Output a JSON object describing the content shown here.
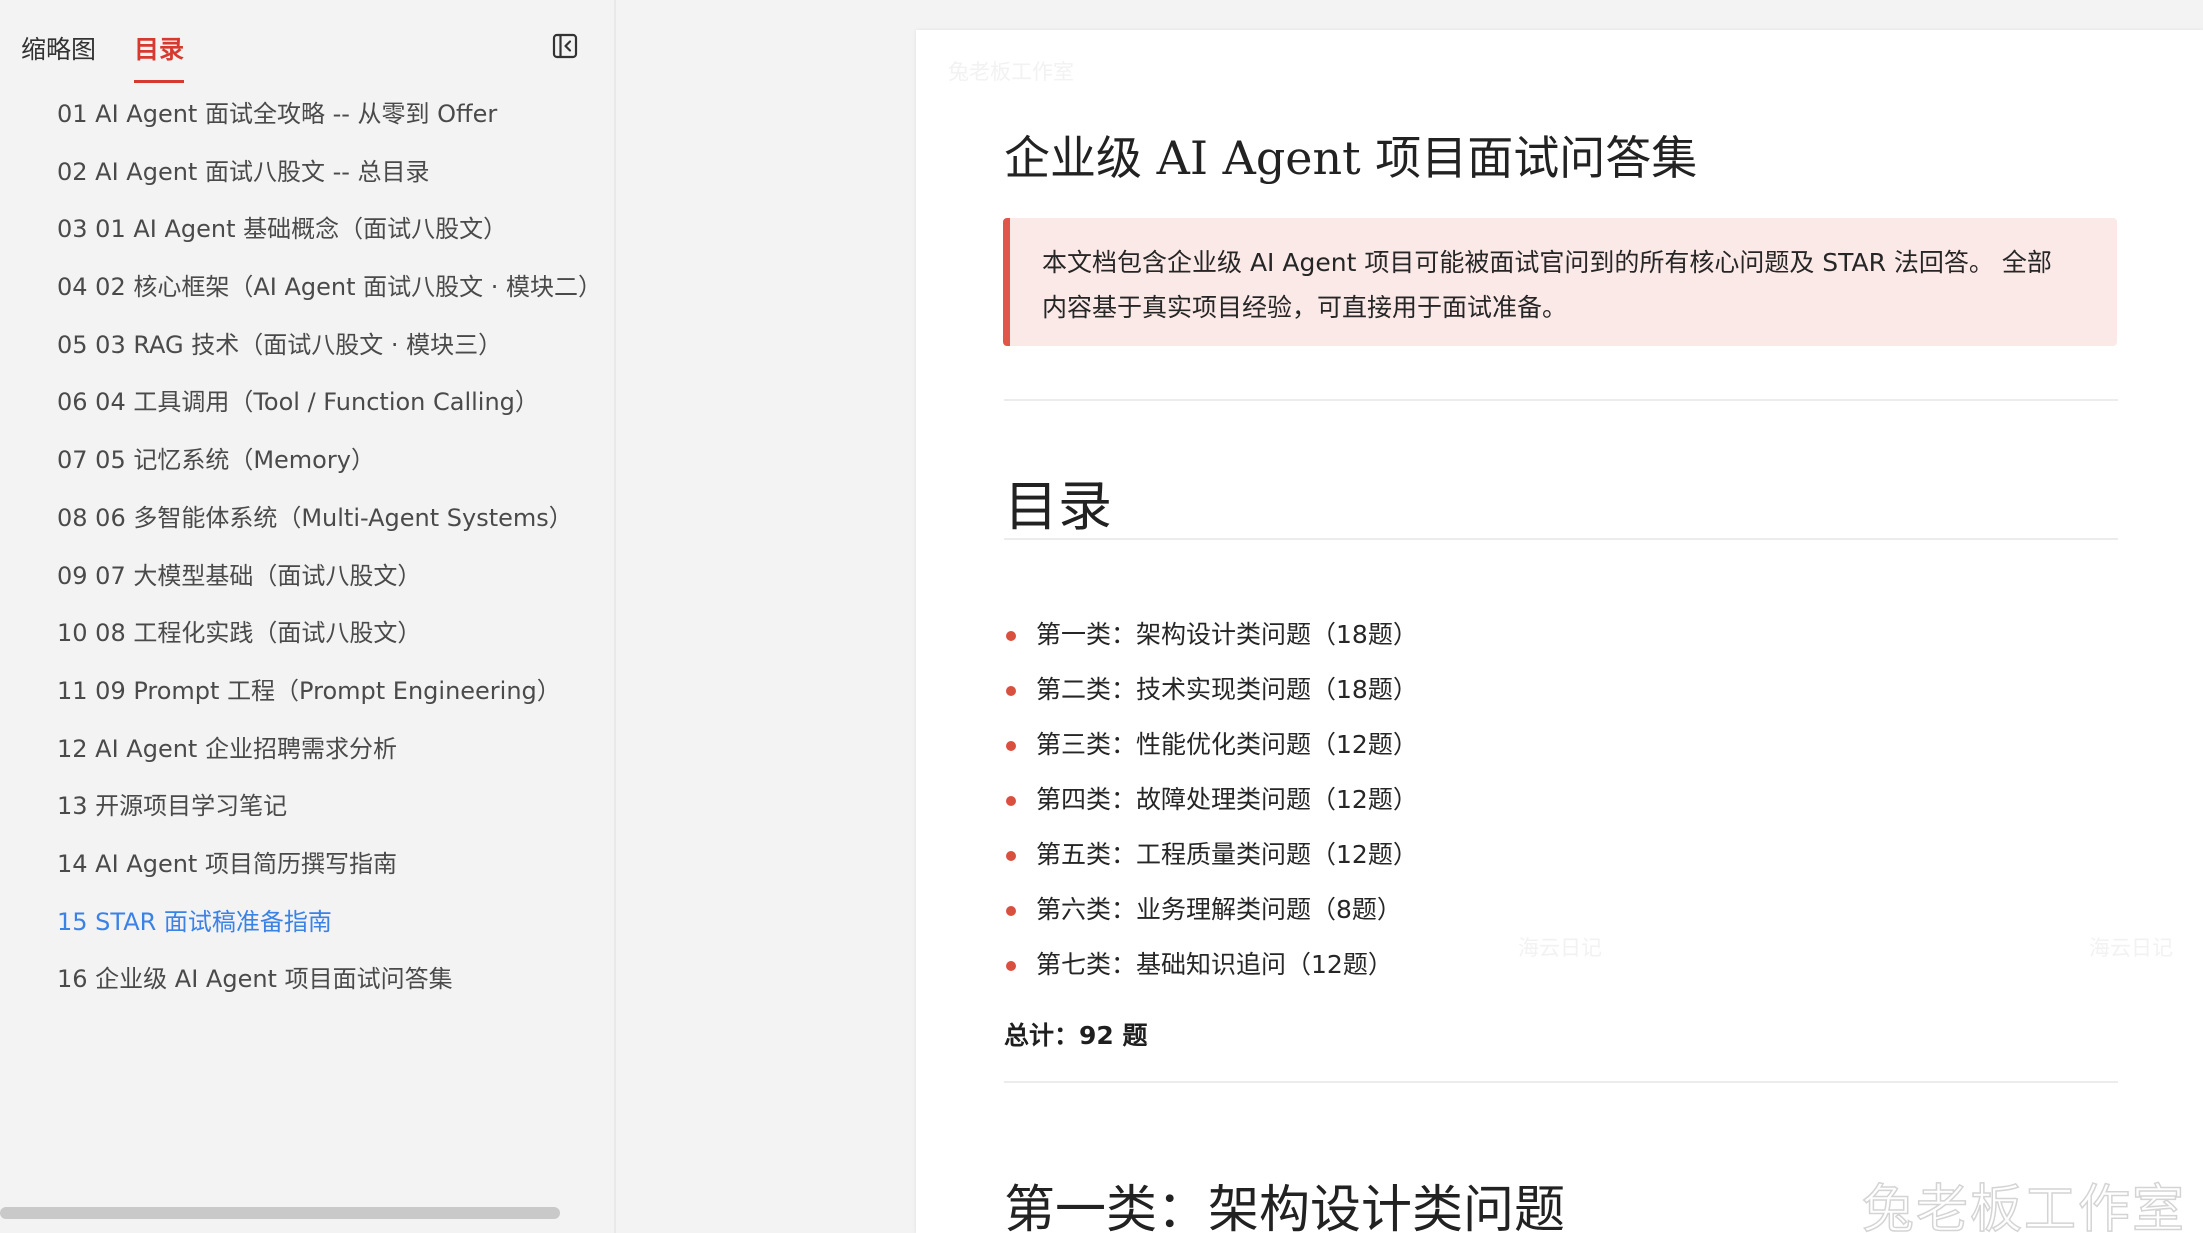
{
  "sidebar": {
    "tabs": [
      "缩略图",
      "目录"
    ],
    "active_tab": "目录",
    "items": [
      "01 AI Agent 面试全攻略 -- 从零到 Offer",
      "02 AI Agent 面试八股文 -- 总目录",
      "03 01 AI Agent 基础概念（面试八股文）",
      "04 02 核心框架（AI Agent 面试八股文 · 模块二）",
      "05 03 RAG 技术（面试八股文 · 模块三）",
      "06 04 工具调用（Tool / Function Calling）",
      "07 05 记忆系统（Memory）",
      "08 06 多智能体系统（Multi-Agent Systems）",
      "09 07 大模型基础（面试八股文）",
      "10 08 工程化实践（面试八股文）",
      "11 09 Prompt 工程（Prompt Engineering）",
      "12 AI Agent 企业招聘需求分析",
      "13 开源项目学习笔记",
      "14 AI Agent 项目简历撰写指南",
      "15 STAR 面试稿准备指南",
      "16 企业级 AI Agent 项目面试问答集"
    ],
    "current_index": 14
  },
  "document": {
    "title": "企业级 AI Agent 项目面试问答集",
    "callout_line1": "本文档包含企业级 AI Agent 项目可能被面试官问到的所有核心问题及 STAR 法回答。 全部",
    "callout_line2": "内容基于真实项目经验，可直接用于面试准备。",
    "toc_heading": "目录",
    "toc_items": [
      "第一类：架构设计类问题（18题）",
      "第二类：技术实现类问题（18题）",
      "第三类：性能优化类问题（12题）",
      "第四类：故障处理类问题（12题）",
      "第五类：工程质量类问题（12题）",
      "第六类：业务理解类问题（8题）",
      "第七类：基础知识追问（12题）"
    ],
    "total": "总计：92 题",
    "section_heading": "第一类：架构设计类问题"
  },
  "watermarks": {
    "top": "兔老板工作室",
    "mid1": "海云日记",
    "mid2": "海云日记",
    "big": "兔老板工作室"
  },
  "colors": {
    "accent": "#d63a2f",
    "link": "#3b82e6",
    "callout_bg": "#fbe9e8",
    "callout_border": "#e0574a"
  }
}
